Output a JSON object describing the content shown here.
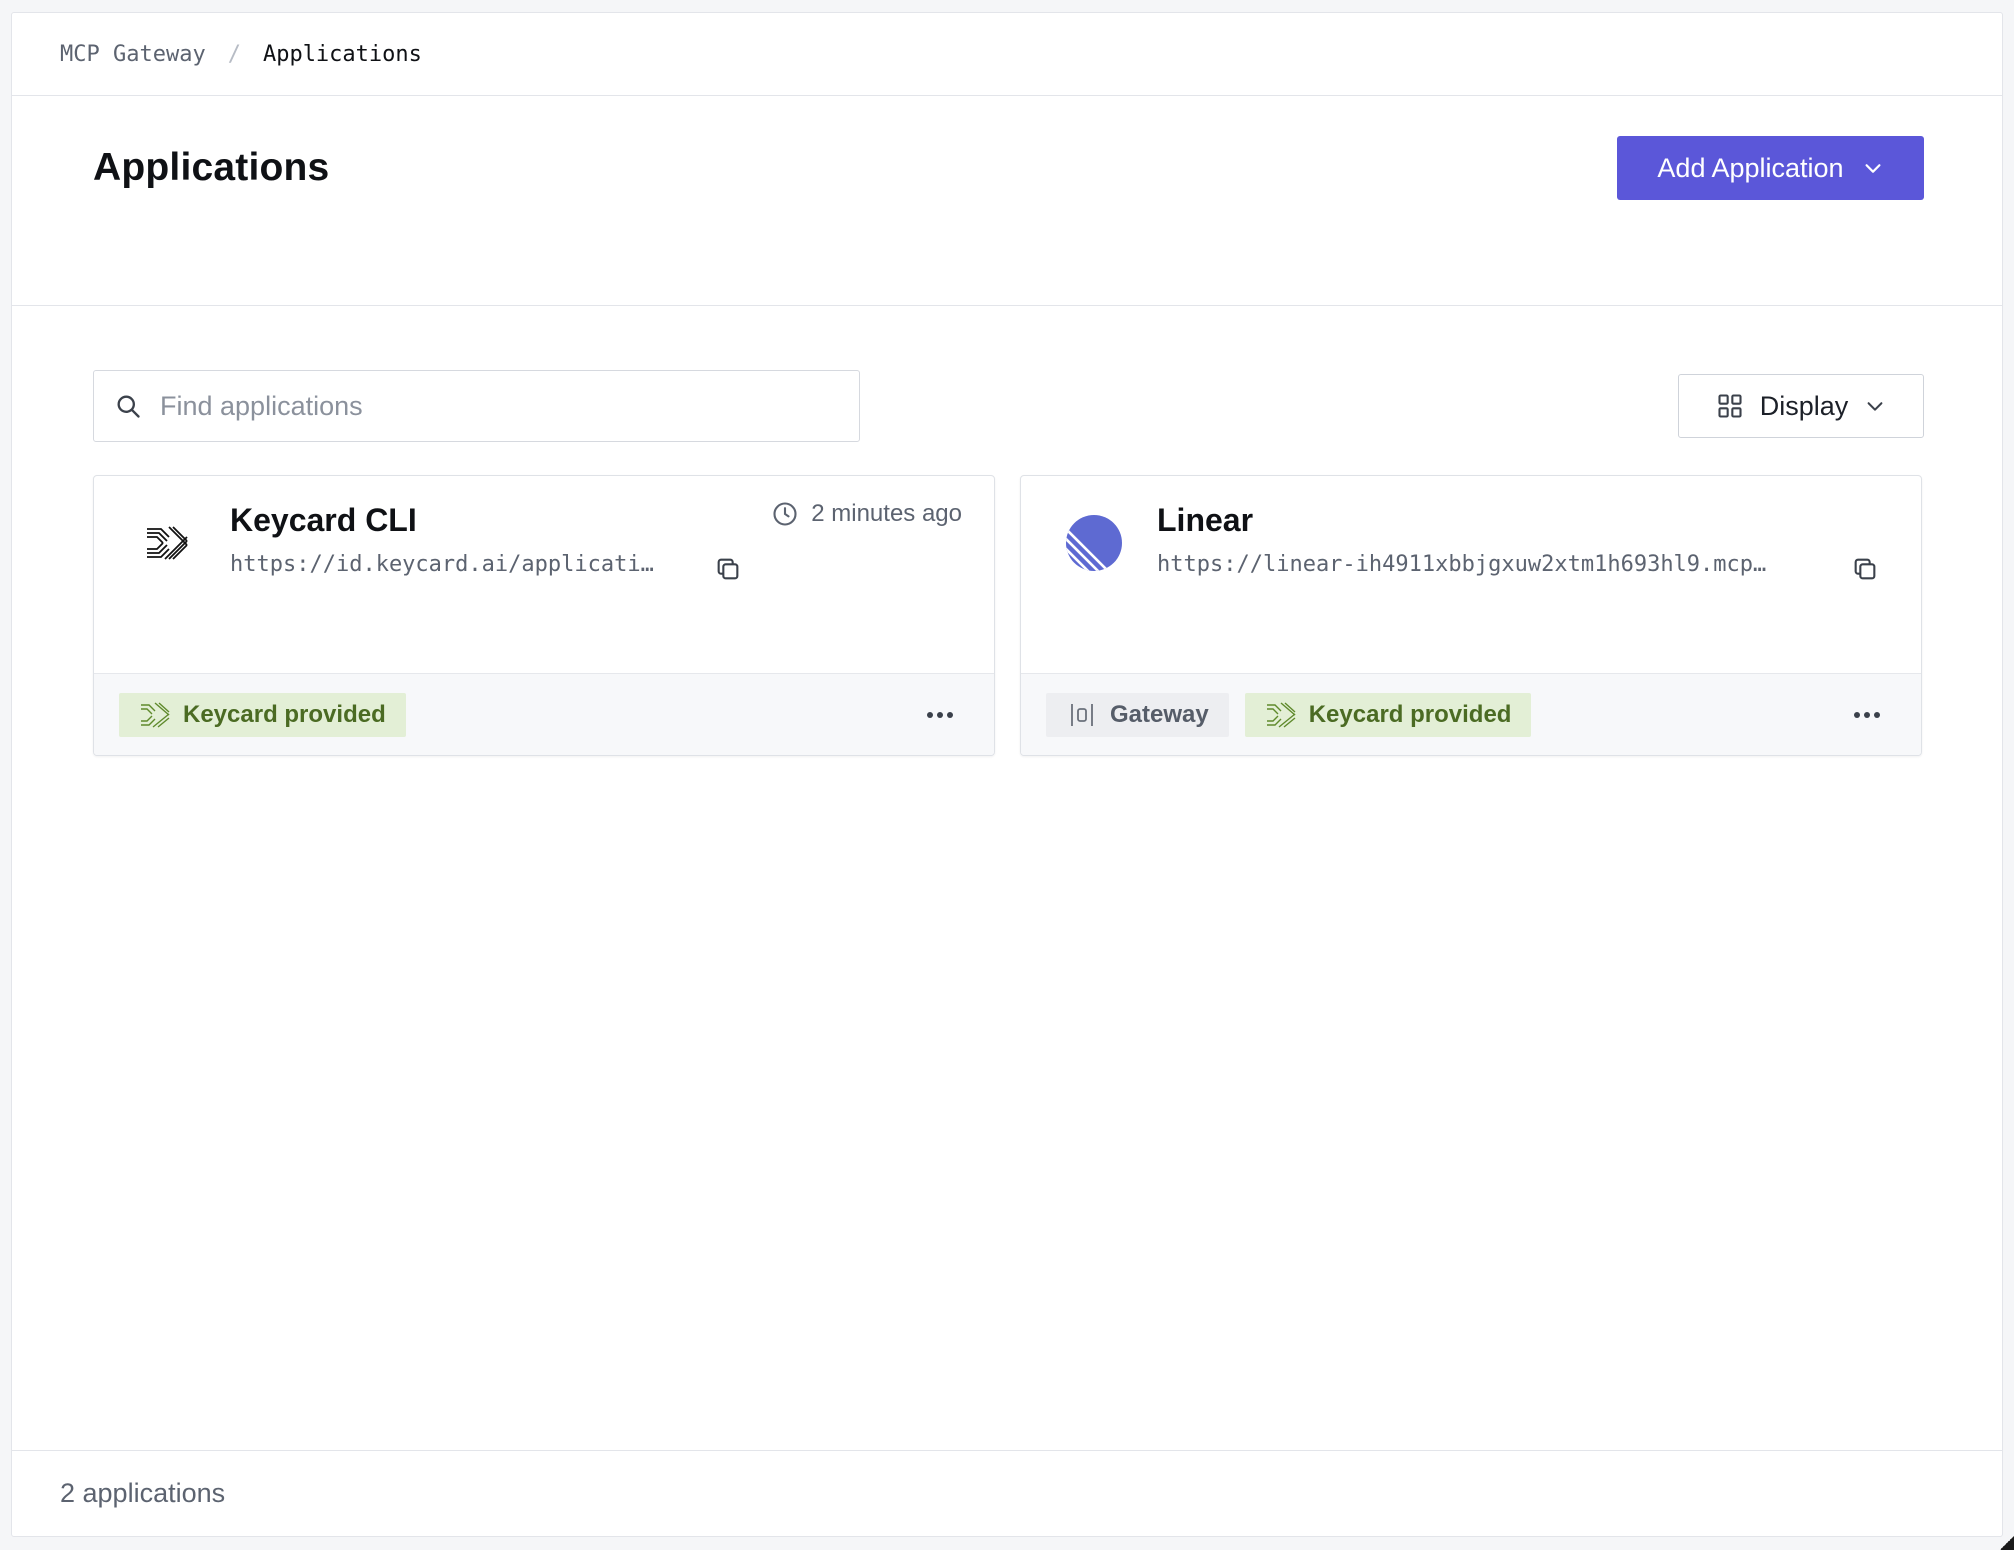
{
  "breadcrumb": {
    "root": "MCP Gateway",
    "separator": "/",
    "current": "Applications"
  },
  "header": {
    "title": "Applications",
    "add_button_label": "Add Application"
  },
  "search": {
    "placeholder": "Find applications",
    "value": ""
  },
  "display_button": {
    "label": "Display"
  },
  "applications": [
    {
      "name": "Keycard CLI",
      "url": "https://id.keycard.ai/applicati…",
      "time": "2 minutes ago",
      "logo": "keycard-logo",
      "tags": [
        {
          "label": "Keycard provided",
          "icon": "keycard-mark-icon"
        }
      ]
    },
    {
      "name": "Linear",
      "url": "https://linear-ih4911xbbjgxuw2xtm1h693hl9.mcp…",
      "time": "",
      "logo": "linear-logo",
      "tags": [
        {
          "label": "Gateway",
          "icon": "gateway-icon"
        },
        {
          "label": "Keycard provided",
          "icon": "keycard-mark-icon"
        }
      ]
    }
  ],
  "footer": {
    "count_text": "2 applications"
  },
  "colors": {
    "accent": "#5b57d9",
    "keycard_tag_bg": "#e3efd6",
    "keycard_tag_text": "#4b6b23",
    "gateway_tag_bg": "#edeef1",
    "linear_logo": "#5e6ad2"
  }
}
